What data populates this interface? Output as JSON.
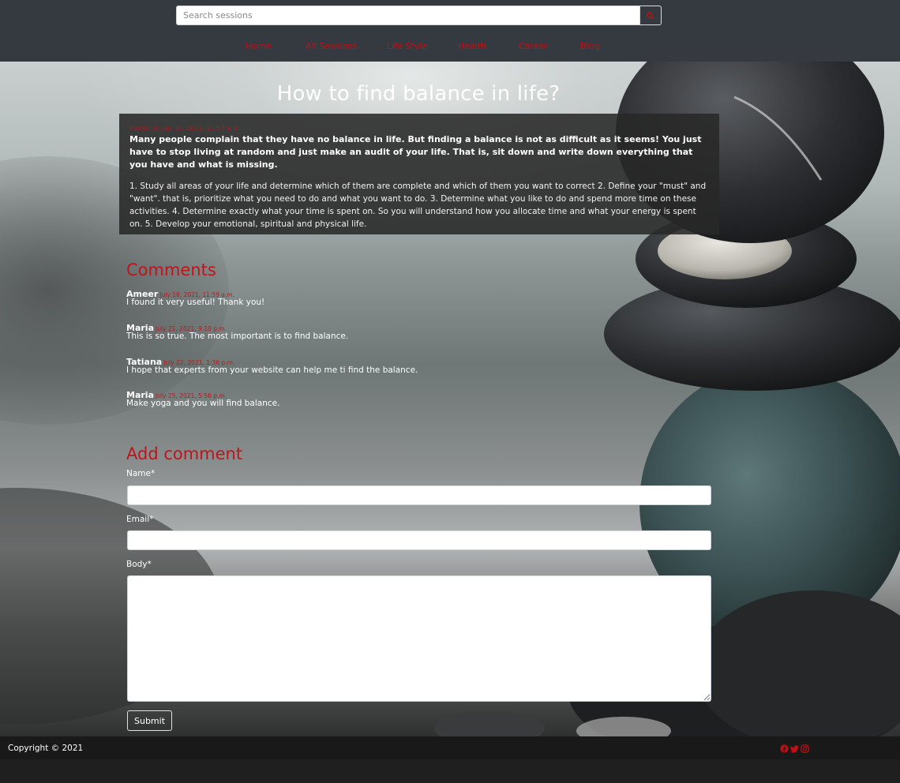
{
  "search": {
    "placeholder": "Search sessions",
    "button_icon": "search-icon"
  },
  "nav": {
    "items": [
      {
        "label": "Home"
      },
      {
        "label": "All Sessions"
      },
      {
        "label": "Life Style"
      },
      {
        "label": "Health"
      },
      {
        "label": "Career"
      },
      {
        "label": "Blog"
      }
    ]
  },
  "article": {
    "title": "How to find balance in life?",
    "posted": "Posted at July 18, 2021, 11:57 a.m.",
    "lead": "Many people complain that they have no balance in life. But finding a balance is not as difficult as it seems! You just have to stop living at random and just make an audit of your life. That is, sit down and write down everything that you have and what is missing.",
    "body": "1. Study all areas of your life and determine which of them are complete and which of them you want to correct 2. Define your \"must\" and \"want\". that is, prioritize what you need to do and what you want to do. 3. Determine what you like to do and spend more time on these activities. 4. Determine exactly what your time is spent on. So you will understand how you allocate time and what your energy is spent on. 5. Develop your emotional, spiritual and physical life."
  },
  "comments": {
    "heading": "Comments",
    "items": [
      {
        "name": "Ameer",
        "date": "July 18, 2021, 11:59 a.m.",
        "body": "I found it very useful! Thank you!"
      },
      {
        "name": "Maria",
        "date": "July 21, 2021, 9:10 p.m.",
        "body": "This is so true. The most important is to find balance."
      },
      {
        "name": "Tatiana",
        "date": "July 22, 2021, 1:36 p.m.",
        "body": "I hope that experts from your website can help me ti find the balance."
      },
      {
        "name": "Maria",
        "date": "July 25, 2021, 5:56 p.m.",
        "body": "Make yoga and you will find balance."
      }
    ]
  },
  "form": {
    "heading": "Add comment",
    "name_label": "Name*",
    "email_label": "Email*",
    "body_label": "Body*",
    "name_value": "",
    "email_value": "",
    "body_value": "",
    "submit_label": "Submit"
  },
  "footer": {
    "copyright": "Copyright © 2021",
    "social_icons": [
      "facebook-icon",
      "twitter-icon",
      "instagram-icon"
    ]
  },
  "colors": {
    "accent": "#c20f16",
    "header_bg": "#343a40",
    "footer_bg": "#191919"
  }
}
